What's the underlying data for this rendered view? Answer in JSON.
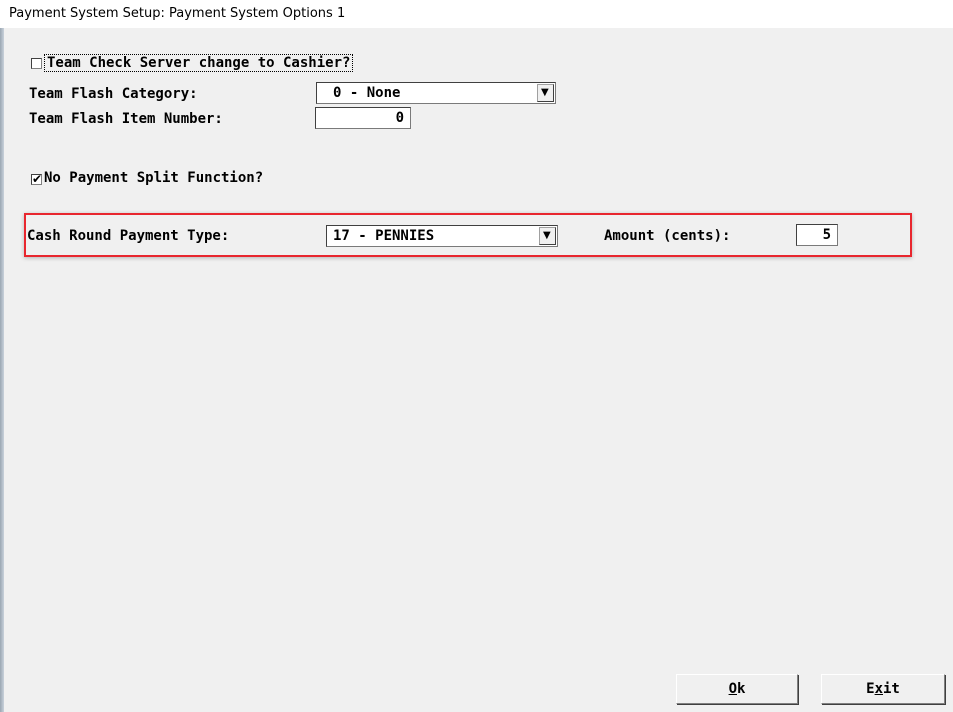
{
  "window": {
    "title": "Payment System Setup:  Payment System Options 1"
  },
  "options": {
    "team_check": {
      "label": "Team Check Server change to Cashier?",
      "checked": false
    },
    "team_flash_category": {
      "label": "Team Flash Category:",
      "value": "0 - None"
    },
    "team_flash_item": {
      "label": "Team Flash Item Number:",
      "value": "0"
    },
    "no_payment_split": {
      "label": "No Payment Split Function?",
      "checked": true
    },
    "cash_round": {
      "label": "Cash Round Payment Type:",
      "value": "17 - PENNIES",
      "amount_label": "Amount (cents):",
      "amount_value": "5"
    }
  },
  "buttons": {
    "ok": {
      "mnemonic": "O",
      "rest": "k"
    },
    "exit": {
      "pre": "E",
      "mnemonic": "x",
      "post": "it"
    }
  },
  "icons": {
    "check_mark": "✔",
    "dropdown_arrow": "▼"
  },
  "colors": {
    "highlight": "#e8262e",
    "background": "#f0f0f0"
  }
}
